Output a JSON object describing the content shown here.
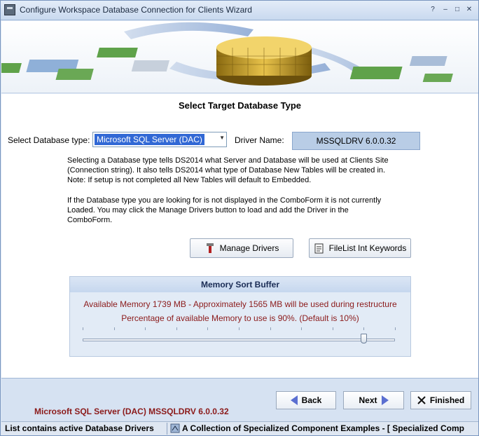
{
  "window": {
    "title": "Configure Workspace Database Connection for Clients Wizard",
    "controls": {
      "help": "?",
      "minimize": "–",
      "maximize": "□",
      "close": "✕"
    }
  },
  "main": {
    "heading": "Select Target Database Type",
    "db_type_label": "Select Database type:",
    "db_type_value": "Microsoft SQL Server (DAC)",
    "driver_label": "Driver Name:",
    "driver_value": "MSSQLDRV  6.0.0.32",
    "info_1": [
      "Selecting a Database type tells DS2014 what Server and Database will be used at Clients Site",
      "(Connection string).  It also tells DS2014 what type of Database New Tables will be created in.",
      "Note:  If setup is not completed all New Tables will default to Embedded."
    ],
    "info_2": [
      "If the Database type you are looking for is not displayed in the ComboForm it is not currently",
      "Loaded.  You may click the Manage Drivers button to load and add the Driver in the",
      "ComboForm."
    ],
    "manage_drivers_label": "Manage Drivers",
    "filelist_label": "FileList Int Keywords"
  },
  "memory": {
    "title": "Memory Sort Buffer",
    "available": "Available Memory 1739 MB - Approximately 1565 MB will be used during restructure",
    "percentage": "Percentage of available Memory to use is 90%. (Default is 10%)",
    "slider_value_percent": 90,
    "tick_count": 10
  },
  "footer": {
    "selected_summary": "Microsoft SQL Server (DAC) MSSQLDRV  6.0.0.32",
    "back_label": "Back",
    "next_label": "Next",
    "finished_label": "Finished"
  },
  "statusbar": {
    "left": "List contains active Database Drivers",
    "right": "A Collection of Specialized Component Examples - [ Specialized Comp"
  },
  "colors": {
    "accent": "#3168d5",
    "message_red": "#8b1a1a",
    "nav_arrow": "#5b6fd1"
  }
}
